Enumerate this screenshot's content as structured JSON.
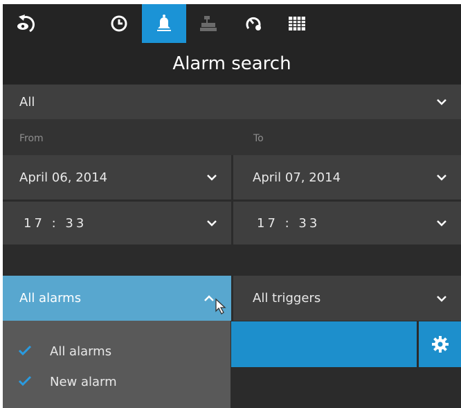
{
  "toolbar": {
    "items": [
      {
        "name": "back-icon",
        "active": false
      },
      {
        "name": "clock-icon",
        "active": false
      },
      {
        "name": "bell-icon",
        "active": true
      },
      {
        "name": "cash-register-icon",
        "active": false
      },
      {
        "name": "gauge-icon",
        "active": false
      },
      {
        "name": "grid-icon",
        "active": false
      }
    ],
    "accent": "#1b93d6"
  },
  "title": "Alarm search",
  "category_select": {
    "value": "All"
  },
  "from": {
    "label": "From",
    "date": "April 06, 2014",
    "time": "17 : 33"
  },
  "to": {
    "label": "To",
    "date": "April 07, 2014",
    "time": "17 : 33"
  },
  "alarm_filter": {
    "value": "All alarms",
    "open": true,
    "options": [
      {
        "label": "All alarms",
        "checked": true
      },
      {
        "label": "New alarm",
        "checked": true
      }
    ]
  },
  "trigger_filter": {
    "value": "All triggers"
  },
  "settings_icon": "gear-icon",
  "colors": {
    "background": "#2b2b2b",
    "field": "#3f3f3f",
    "open_field": "#58a7cf",
    "search_bar": "#1d8fcc",
    "checkmark": "#2a9be0"
  }
}
